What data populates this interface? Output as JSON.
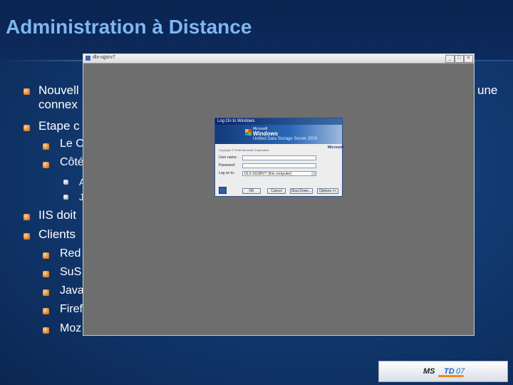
{
  "slide": {
    "title": "Administration à Distance"
  },
  "bullets": [
    {
      "text": "Nouvell",
      "level": 1
    },
    {
      "text": "une",
      "level": 1
    },
    {
      "text": "connex",
      "level": 1
    },
    {
      "text": "Etape c",
      "level": 1
    },
    {
      "text": "Le C",
      "level": 2
    },
    {
      "text": "Côté",
      "level": 2
    },
    {
      "text": "A",
      "level": 3
    },
    {
      "text": "J",
      "level": 3
    },
    {
      "text": "IIS doit",
      "level": 1
    },
    {
      "text": "Clients",
      "level": 1
    },
    {
      "text": "Red",
      "level": 2
    },
    {
      "text": "SuS",
      "level": 2
    },
    {
      "text": "Java",
      "level": 2
    },
    {
      "text": "Firef",
      "level": 2
    },
    {
      "text": "Moz",
      "level": 2
    }
  ],
  "remote_window": {
    "title": "dlx-sgsrv7",
    "icon": "remote-desktop-icon",
    "buttons": [
      "_",
      "□",
      "×"
    ]
  },
  "login_dialog": {
    "title": "Log On to Windows",
    "brand_line1": "Microsoft",
    "brand_line2": "Windows",
    "brand_line3": "Unified Data Storage Server 2003",
    "ms_logo": "Microsoft",
    "copyright": "Copyright © 2006 Microsoft Corporation",
    "user_label": "User name:",
    "user_value": "",
    "password_label": "Password:",
    "password_value": "",
    "logon_label": "Log on to:",
    "logon_value": "DLX-SGSRV7 (this computer)",
    "buttons": {
      "ok": "OK",
      "cancel": "Cancel",
      "shutdown": "Shut Down...",
      "options": "Options <<"
    }
  },
  "footer": {
    "logo_part1": "MS",
    "logo_part2": "TD",
    "logo_part3": "07"
  },
  "colors": {
    "title": "#7fb6f2",
    "background": "#123a72",
    "bullet": "#e07a1f",
    "remote_desktop_bg": "#6e6e6e"
  }
}
